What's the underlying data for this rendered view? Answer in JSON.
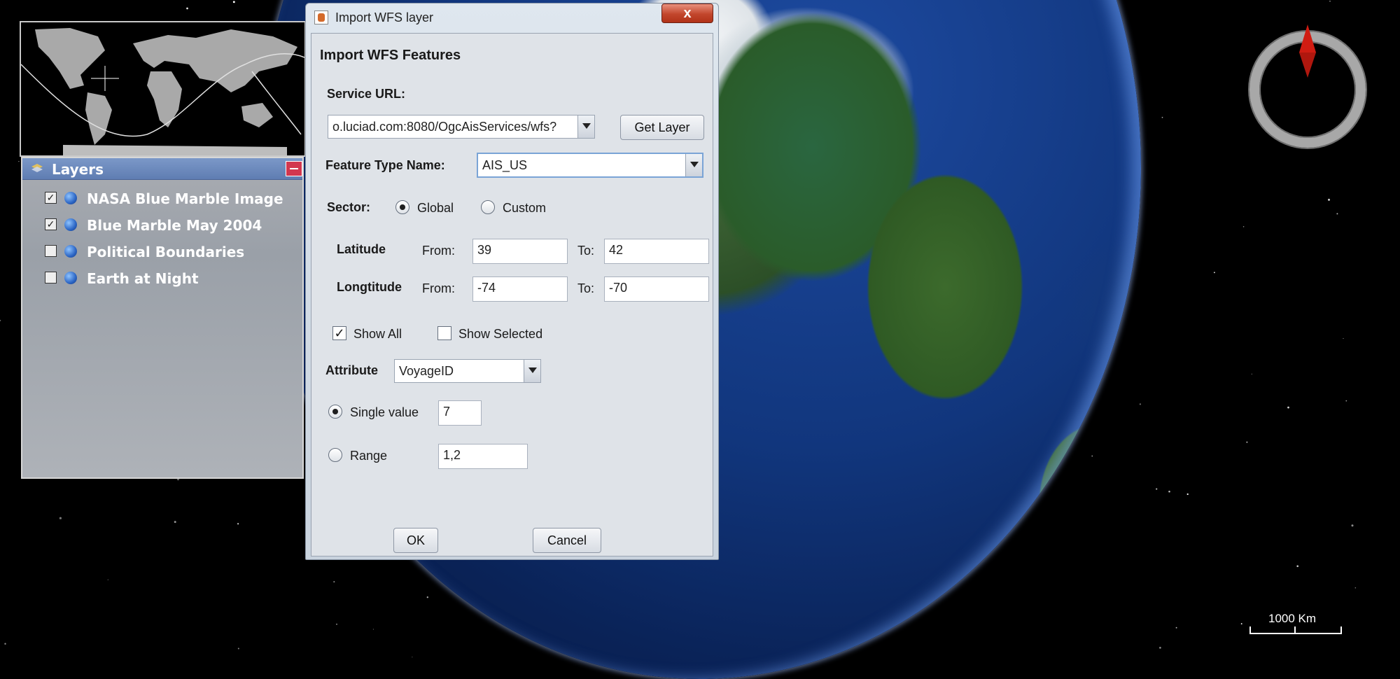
{
  "layers_panel": {
    "title": "Layers",
    "items": [
      {
        "label": "NASA Blue Marble Image",
        "checked": true,
        "check_glyph": "✓"
      },
      {
        "label": "Blue Marble May 2004",
        "checked": true,
        "check_glyph": "✓"
      },
      {
        "label": "Political Boundaries",
        "checked": false,
        "check_glyph": ""
      },
      {
        "label": "Earth at Night",
        "checked": false,
        "check_glyph": ""
      }
    ]
  },
  "dialog": {
    "window_title": "Import WFS layer",
    "close_glyph": "x",
    "heading": "Import WFS Features",
    "service_url": {
      "label": "Service URL:",
      "value": "o.luciad.com:8080/OgcAisServices/wfs?",
      "get_layer_label": "Get Layer"
    },
    "feature_type": {
      "label": "Feature Type Name:",
      "value": "AIS_US"
    },
    "sector": {
      "label": "Sector:",
      "global_label": "Global",
      "custom_label": "Custom",
      "selected": "Global"
    },
    "latitude": {
      "label": "Latitude",
      "from_label": "From:",
      "from_value": "39",
      "to_label": "To:",
      "to_value": "42"
    },
    "longitude": {
      "label": "Longtitude",
      "from_label": "From:",
      "from_value": "-74",
      "to_label": "To:",
      "to_value": "-70"
    },
    "show_all": {
      "label": "Show All",
      "checked": true,
      "glyph": "✓"
    },
    "show_selected": {
      "label": "Show Selected",
      "checked": false,
      "glyph": ""
    },
    "attribute": {
      "label": "Attribute",
      "value": "VoyageID"
    },
    "single_value": {
      "label": "Single value",
      "value": "7",
      "selected": true
    },
    "range": {
      "label": "Range",
      "value": "1,2",
      "selected": false
    },
    "ok_label": "OK",
    "cancel_label": "Cancel"
  },
  "map": {
    "scale_label": "1000 Km",
    "compass_icon": "compass-icon"
  },
  "colors": {
    "layers_header": "#6a88bd",
    "close_button": "#c2462c",
    "needle": "#d01c12"
  }
}
